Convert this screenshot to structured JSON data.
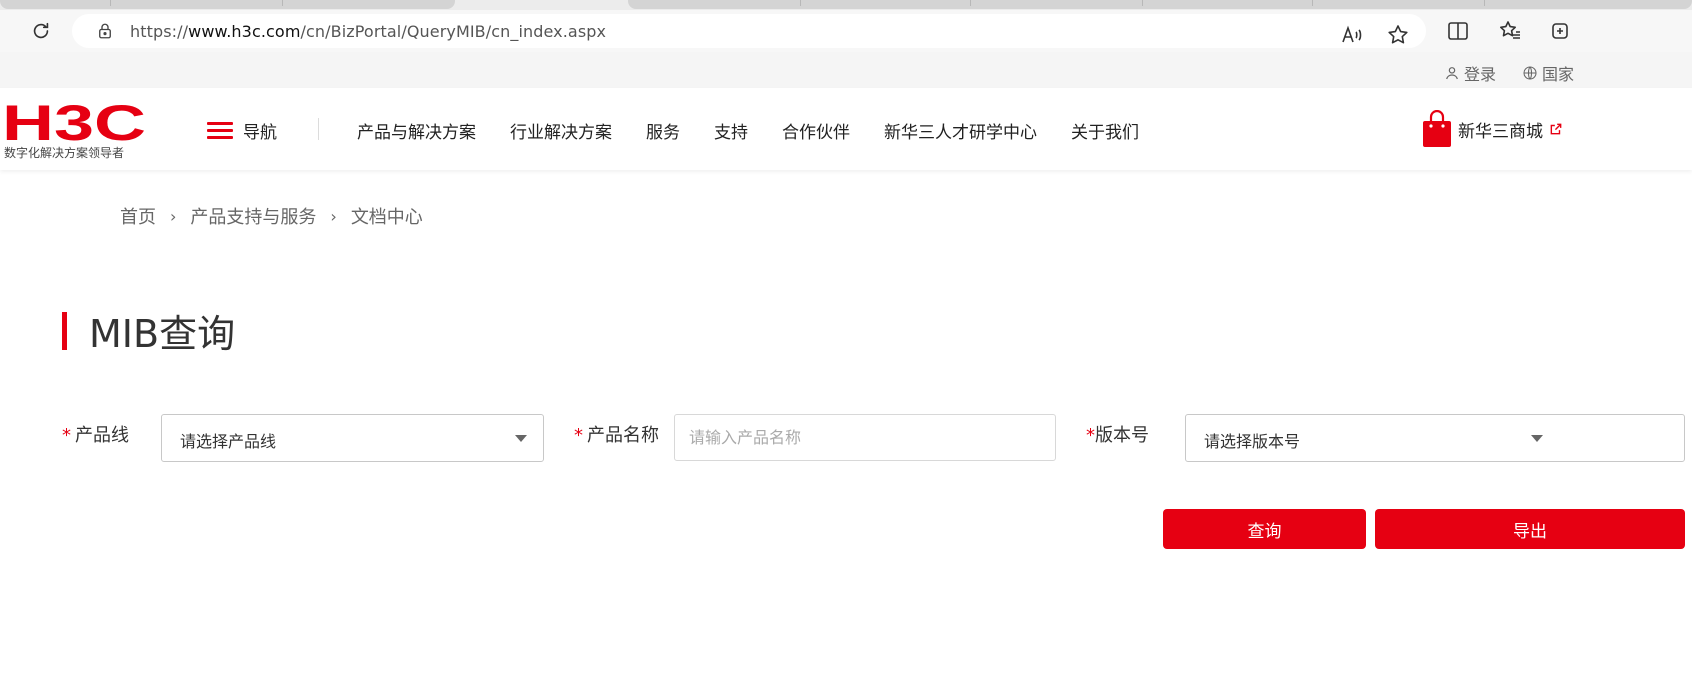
{
  "browser": {
    "url_prefix": "https://",
    "url_host": "www.h3c.com",
    "url_path": "/cn/BizPortal/QueryMIB/cn_index.aspx"
  },
  "topbar": {
    "login_label": "登录",
    "region_label": "国家"
  },
  "header": {
    "logo_text": "H3C",
    "logo_slogan": "数字化解决方案领导者",
    "nav_toggle_label": "导航",
    "menu": [
      "产品与解决方案",
      "行业解决方案",
      "服务",
      "支持",
      "合作伙伴",
      "新华三人才研学中心",
      "关于我们"
    ],
    "shop_label": "新华三商城"
  },
  "breadcrumb": {
    "items": [
      "首页",
      "产品支持与服务",
      "文档中心"
    ],
    "separator": "›"
  },
  "page": {
    "title": "MIB查询"
  },
  "form": {
    "required_mark": "*",
    "product_line": {
      "label": "产品线",
      "value": "请选择产品线"
    },
    "product_name": {
      "label": "产品名称",
      "placeholder": "请输入产品名称"
    },
    "version": {
      "label": "版本号",
      "value": "请选择版本号"
    },
    "query_button": "查询",
    "export_button": "导出"
  },
  "colors": {
    "brand_red": "#e60012"
  }
}
